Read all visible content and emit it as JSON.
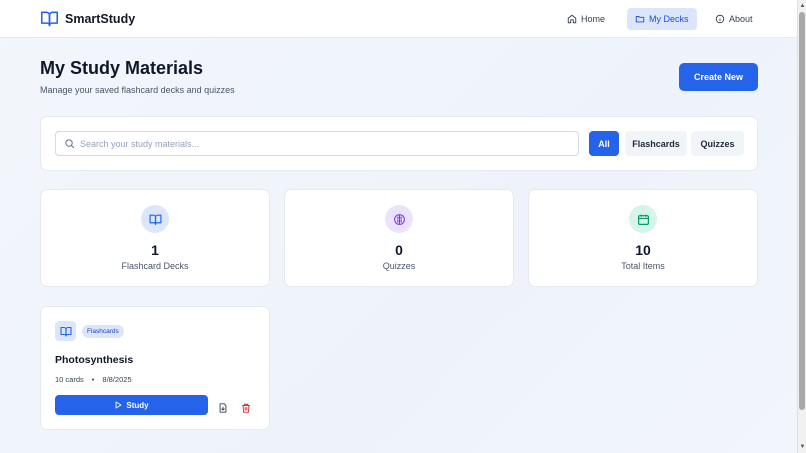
{
  "app": {
    "brand": "SmartStudy"
  },
  "nav": {
    "items": [
      {
        "label": "Home",
        "icon": "home-icon"
      },
      {
        "label": "My Decks",
        "icon": "folder-icon",
        "active": true
      },
      {
        "label": "About",
        "icon": "info-icon"
      }
    ]
  },
  "header": {
    "title": "My Study Materials",
    "subtitle": "Manage your saved flashcard decks and quizzes",
    "create_label": "Create New"
  },
  "search": {
    "placeholder": "Search your study materials...",
    "value": ""
  },
  "filters": [
    {
      "label": "All",
      "active": true
    },
    {
      "label": "Flashcards",
      "active": false
    },
    {
      "label": "Quizzes",
      "active": false
    }
  ],
  "stats": [
    {
      "value": "1",
      "label": "Flashcard Decks",
      "icon": "book-icon",
      "color": "#2563eb",
      "bg": "#dbe6fb"
    },
    {
      "value": "0",
      "label": "Quizzes",
      "icon": "brain-icon",
      "color": "#7c3aed",
      "bg": "#e9e3fb"
    },
    {
      "value": "10",
      "label": "Total Items",
      "icon": "calendar-icon",
      "color": "#059669",
      "bg": "#d5f5ea"
    }
  ],
  "decks": [
    {
      "badge": "Flashcards",
      "title": "Photosynthesis",
      "count": "10 cards",
      "separator": "•",
      "date": "8/8/2025",
      "study_label": "Study"
    }
  ],
  "colors": {
    "accent": "#2563eb",
    "danger": "#dc2626"
  }
}
